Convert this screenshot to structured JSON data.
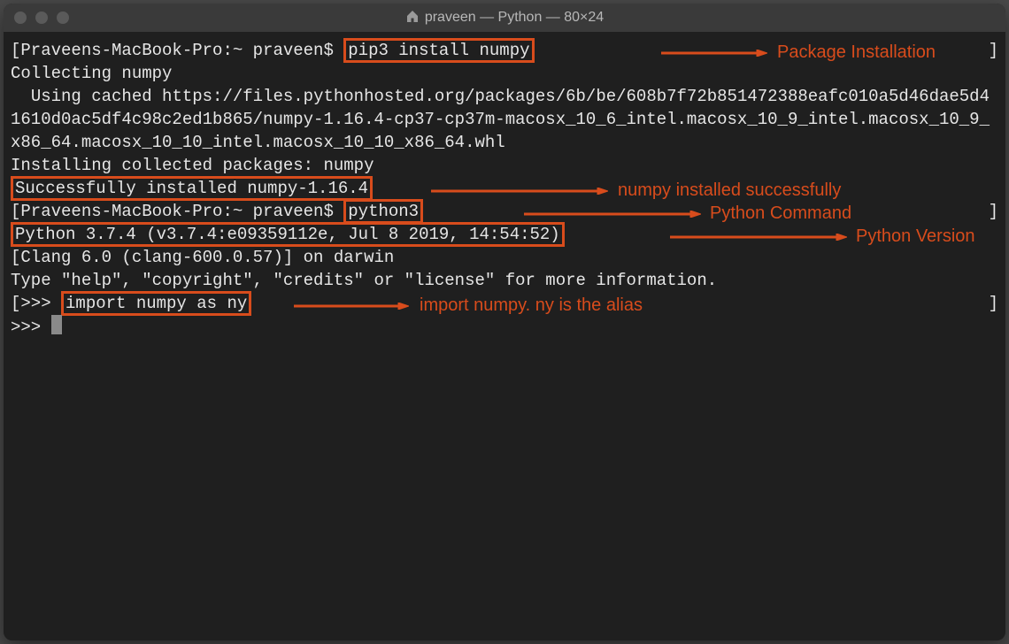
{
  "window": {
    "title": "praveen — Python — 80×24"
  },
  "terminal": {
    "prompt1_prefix": "[Praveens-MacBook-Pro:~ praveen$ ",
    "cmd_pip": "pip3 install numpy",
    "right_bracket": "]",
    "out_collecting": "Collecting numpy",
    "out_cached": "  Using cached https://files.pythonhosted.org/packages/6b/be/608b7f72b851472388eafc010a5d46dae5d41610d0ac5df4c98c2ed1b865/numpy-1.16.4-cp37-cp37m-macosx_10_6_intel.macosx_10_9_intel.macosx_10_9_x86_64.macosx_10_10_intel.macosx_10_10_x86_64.whl",
    "out_installing": "Installing collected packages: numpy",
    "out_success": "Successfully installed numpy-1.16.4",
    "prompt2_prefix": "[Praveens-MacBook-Pro:~ praveen$ ",
    "cmd_python": "python3",
    "out_pyver": "Python 3.7.4 (v3.7.4:e09359112e, Jul  8 2019, 14:54:52)",
    "out_clang": "[Clang 6.0 (clang-600.0.57)] on darwin",
    "out_help": "Type \"help\", \"copyright\", \"credits\" or \"license\" for more information.",
    "repl1_prefix": "[>>> ",
    "cmd_import": "import numpy as ny",
    "repl2": ">>> "
  },
  "annotations": {
    "a1": "Package Installation",
    "a2": "numpy installed successfully",
    "a3": "Python Command",
    "a4": "Python Version",
    "a5": "import numpy. ny is the alias"
  }
}
